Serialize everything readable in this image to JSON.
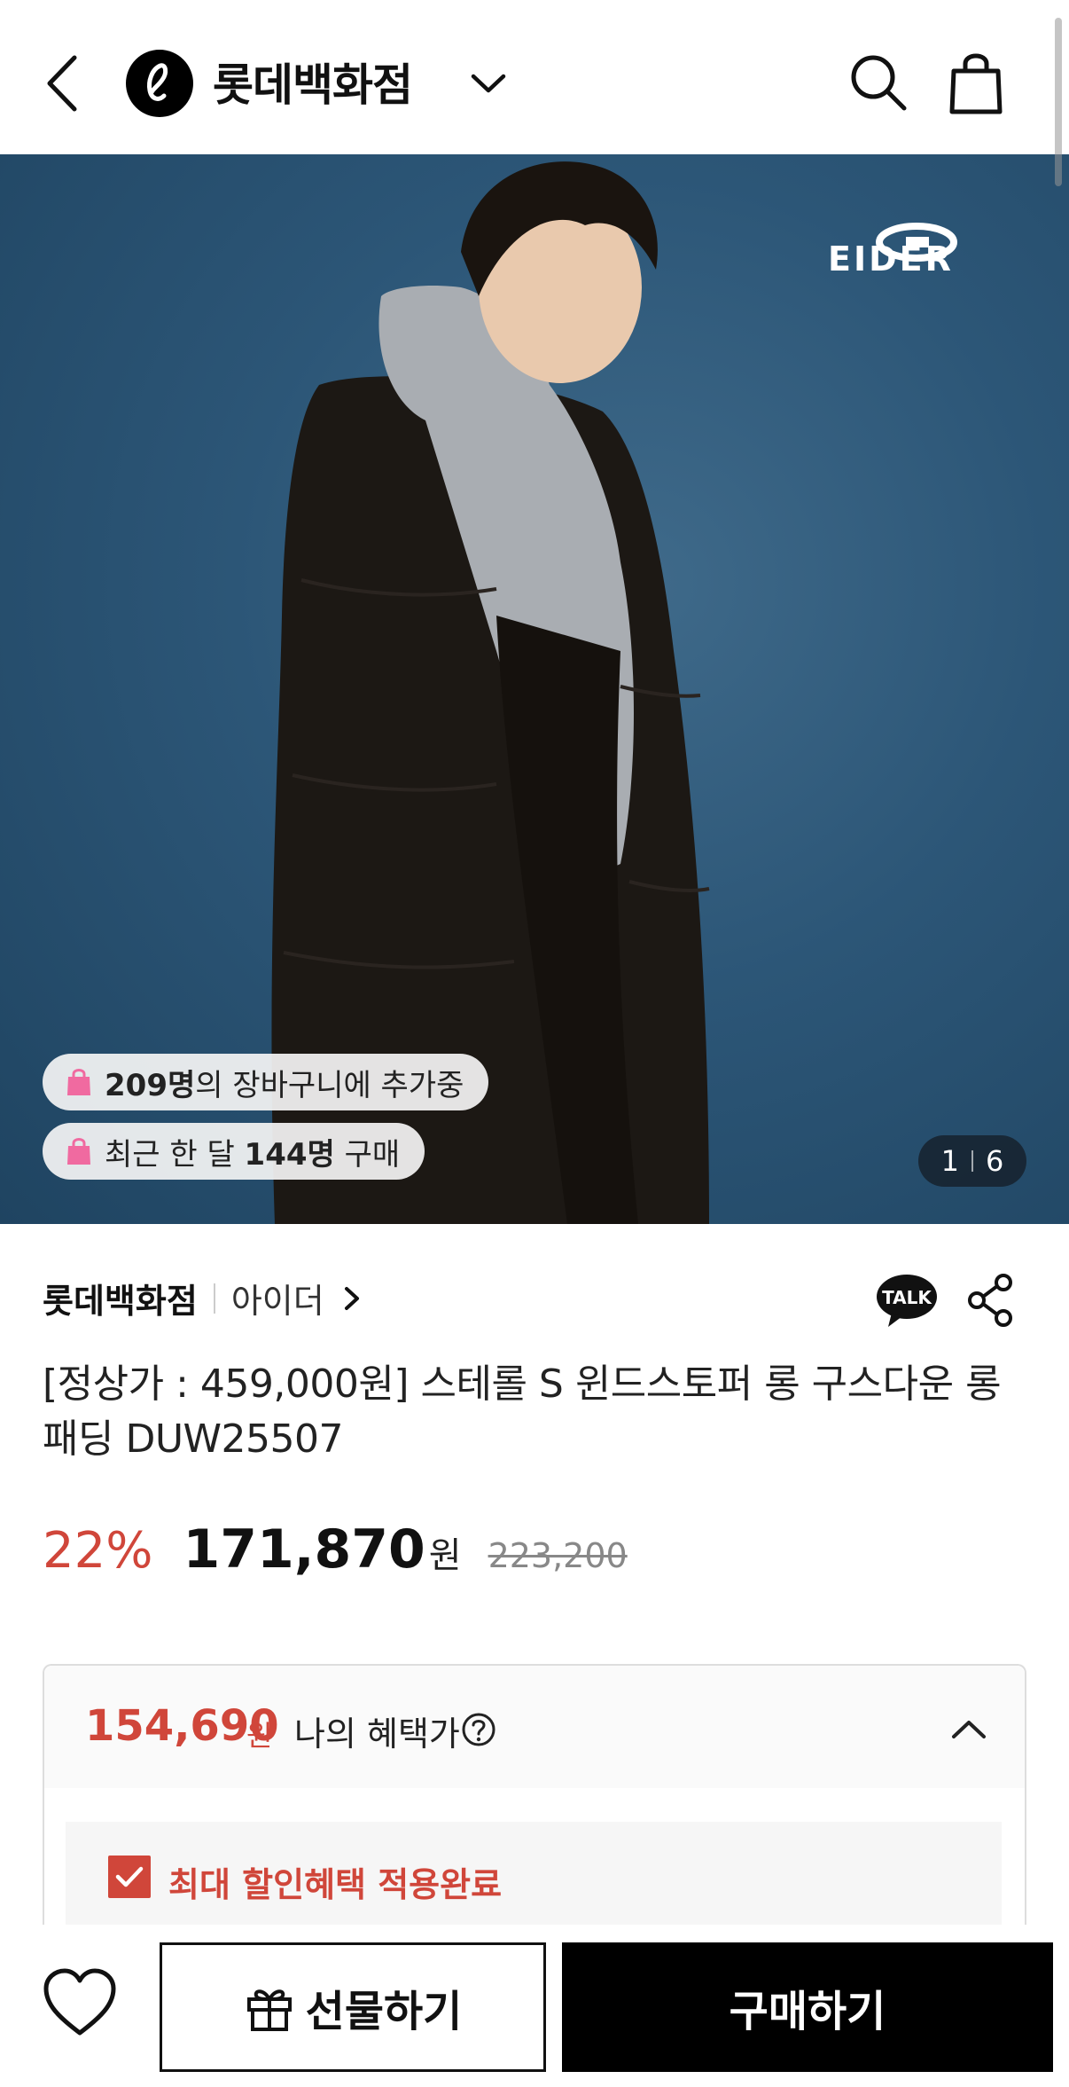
{
  "header": {
    "store_name": "롯데백화점",
    "icons": [
      "back-icon",
      "lotte-logo-icon",
      "chevron-down-icon",
      "search-icon",
      "shopping-bag-icon"
    ]
  },
  "hero": {
    "brand_logo_text": "EIDER",
    "cart_count_badge": {
      "count": "209명",
      "rest": "의 장바구니에 추가중"
    },
    "monthly_purchase_badge": {
      "prefix": "최근 한 달 ",
      "count": "144명",
      "suffix": " 구매"
    },
    "image_counter": {
      "current": "1",
      "total": "6"
    }
  },
  "product": {
    "store": "롯데백화점",
    "brand": "아이더",
    "title": "[정상가 : 459,000원] 스테롤 S 윈드스토퍼 롱 구스다운 롱패딩 DUW25507",
    "discount": "22%",
    "price": "171,870",
    "price_unit": "원",
    "original_price": "223,200",
    "talk_label": "TALK"
  },
  "benefit": {
    "price": "154,690",
    "price_unit": "원",
    "label": "나의 혜택가",
    "applied_text": "최대 할인혜택 적용완료"
  },
  "bottom_bar": {
    "gift_label": "선물하기",
    "buy_label": "구매하기"
  },
  "colors": {
    "accent_red": "#d0463a",
    "black": "#000000",
    "hero_bg": "#2c5677"
  }
}
